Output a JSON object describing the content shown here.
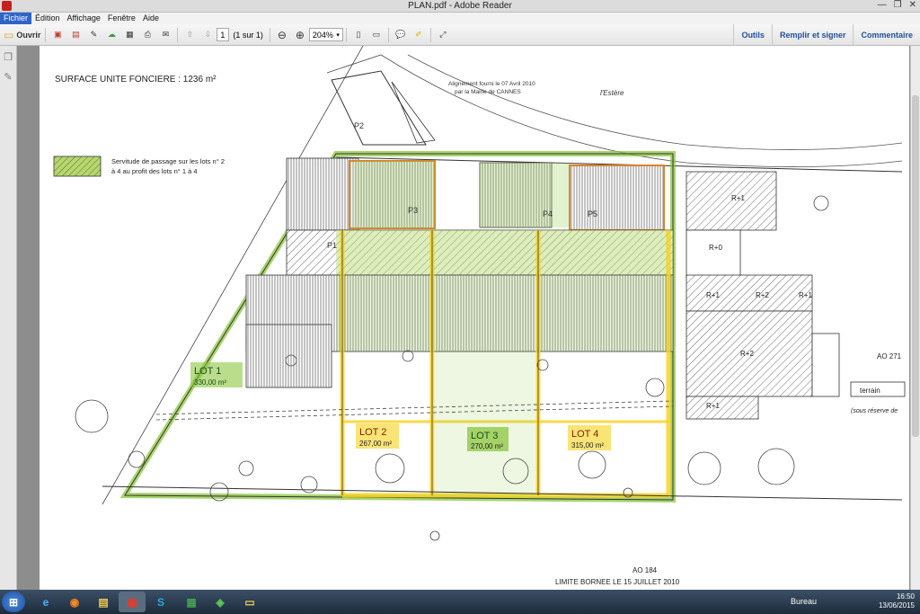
{
  "window": {
    "title": "PLAN.pdf - Adobe Reader"
  },
  "menus": [
    "Fichier",
    "Édition",
    "Affichage",
    "Fenêtre",
    "Aide"
  ],
  "toolbar": {
    "open_label": "Ouvrir",
    "page_current": "1",
    "page_total": "(1 sur 1)",
    "zoom": "204%",
    "links": [
      "Outils",
      "Remplir et signer",
      "Commentaire"
    ]
  },
  "plan": {
    "surface_title": "SURFACE UNITE FONCIERE : 1236 m²",
    "legend_line1": "Servitude de passage sur les lots n° 2",
    "legend_line2": "à 4 au profit des lots n° 1 à 4",
    "alignment_line1": "Alignement fourni le 07 Avril 2010",
    "alignment_line2": "par la Mairie de CANNES",
    "estere": "l'Estère",
    "bottom_ref": "AO 184",
    "bottom_limit": "LIMITE BORNEE LE 15 JUILLET 2010",
    "right_ref": "AO 271",
    "terrain_label": "terrain",
    "reserve_label": "(sous réserve de",
    "lots": [
      {
        "name": "LOT 1",
        "area": "330,00 m²"
      },
      {
        "name": "LOT 2",
        "area": "267,00 m²"
      },
      {
        "name": "LOT 3",
        "area": "270,00 m²"
      },
      {
        "name": "LOT 4",
        "area": "315,00 m²"
      }
    ],
    "parkings": [
      "P1",
      "P2",
      "P3",
      "P4",
      "P5"
    ],
    "buildings": [
      "R+1",
      "R+0",
      "R+1",
      "R+2",
      "R+1",
      "R+2",
      "R+1"
    ]
  },
  "taskbar": {
    "bureau_label": "Bureau",
    "time": "16:50",
    "date": "13/06/2015"
  },
  "colors": {
    "menu_active": "#2f65c8",
    "toolbar_link": "#1f4f9a",
    "green_highlight": "#8cc63f",
    "yellow_highlight": "#f7d21a",
    "orange_outline": "#d9842a"
  }
}
